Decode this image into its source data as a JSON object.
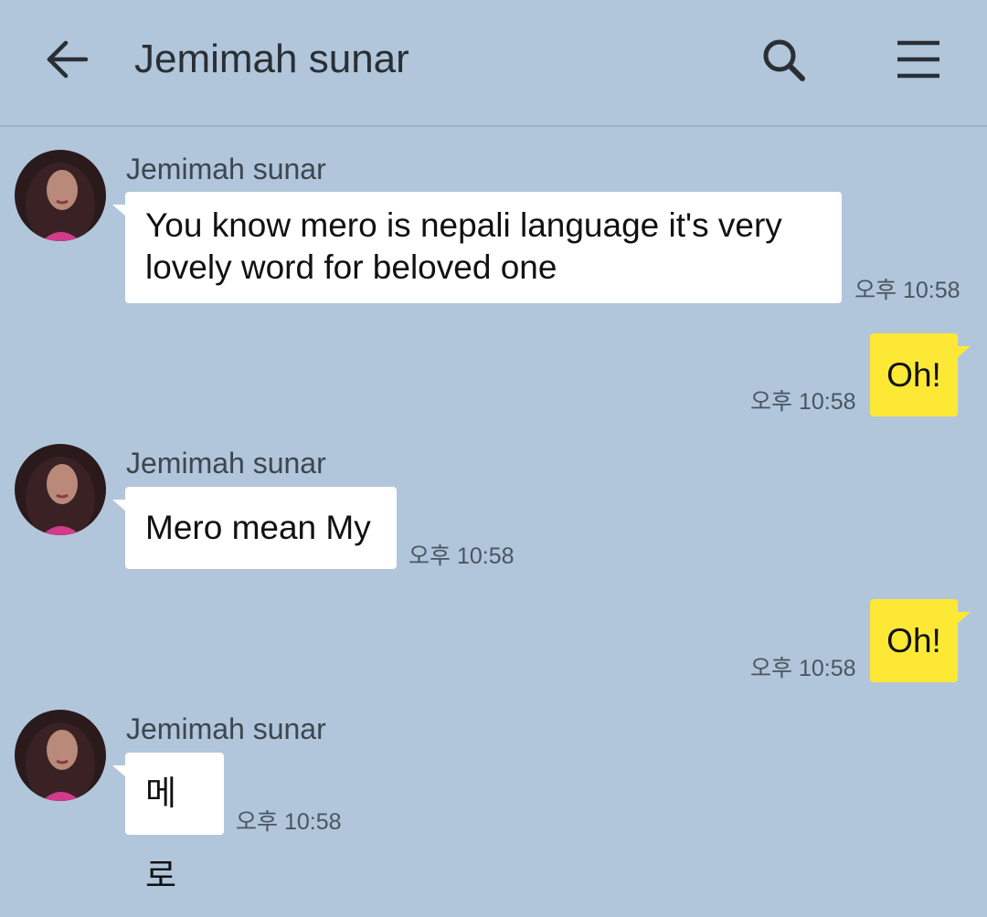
{
  "header": {
    "title": "Jemimah sunar",
    "back_icon": "arrow-left-icon",
    "search_icon": "search-icon",
    "menu_icon": "hamburger-menu-icon"
  },
  "colors": {
    "background": "#b1c6da",
    "incoming_bubble": "#ffffff",
    "outgoing_bubble": "#fde935"
  },
  "messages": [
    {
      "direction": "incoming",
      "sender": "Jemimah sunar",
      "text_line1": "You know mero is nepali language it's very",
      "text_line2": "lovely word for beloved one",
      "time": "오후 10:58"
    },
    {
      "direction": "outgoing",
      "text": "Oh!",
      "time": "오후 10:58"
    },
    {
      "direction": "incoming",
      "sender": "Jemimah sunar",
      "text": "Mero mean My",
      "time": "오후 10:58"
    },
    {
      "direction": "outgoing",
      "text": "Oh!",
      "time": "오후 10:58"
    },
    {
      "direction": "incoming",
      "sender": "Jemimah sunar",
      "text": "메로",
      "time": "오후 10:58"
    }
  ]
}
